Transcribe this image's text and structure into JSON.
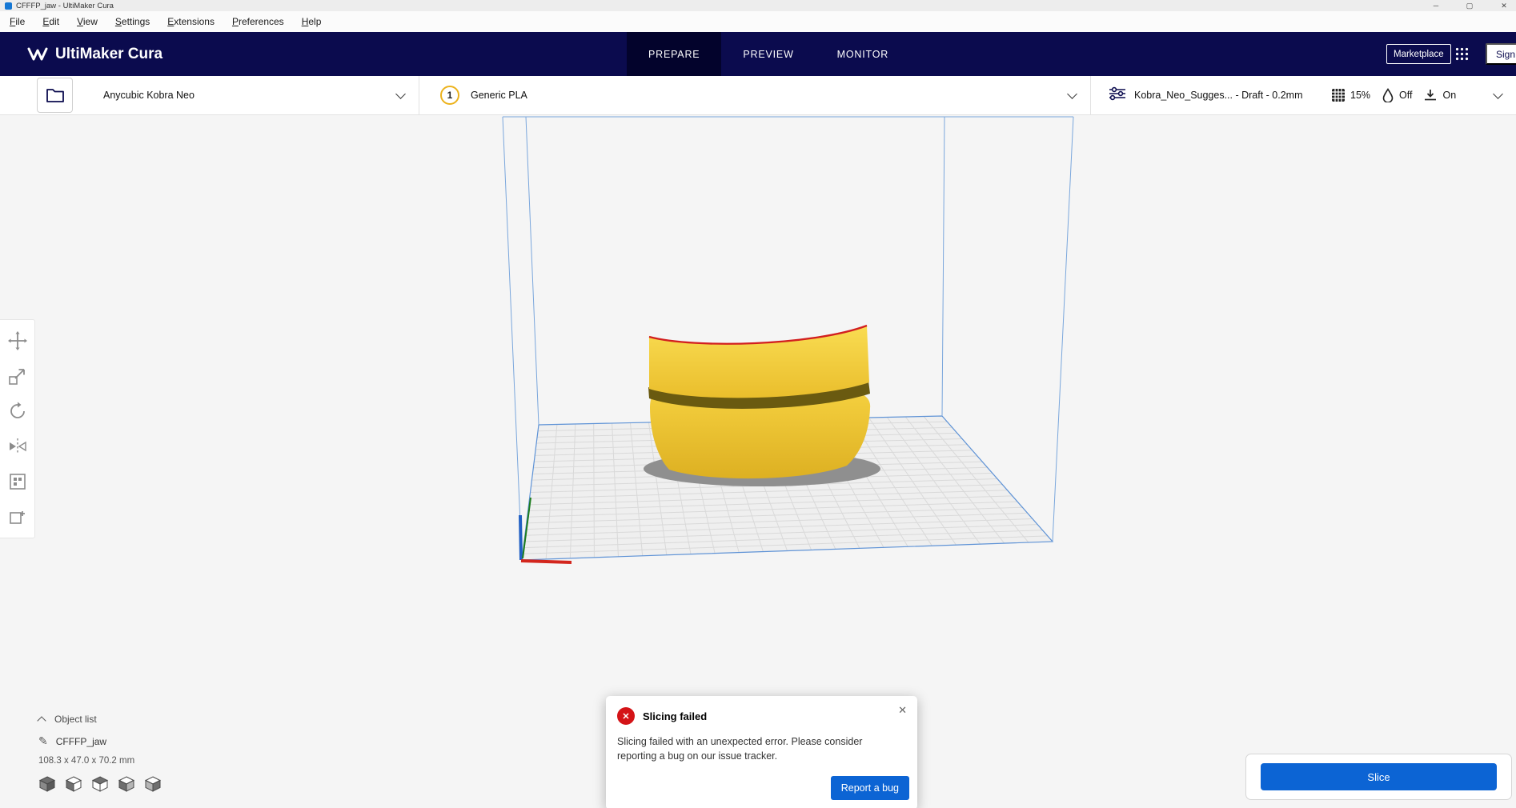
{
  "window": {
    "title": "CFFFP_jaw - UltiMaker Cura"
  },
  "icons": {
    "minimize": "─",
    "maximize": "▢",
    "close": "✕",
    "dialog_close": "✕",
    "error_cross": "✕",
    "pencil": "✎"
  },
  "menu": {
    "items": [
      "File",
      "Edit",
      "View",
      "Settings",
      "Extensions",
      "Preferences",
      "Help"
    ]
  },
  "header": {
    "app_name": "UltiMaker Cura",
    "tabs": [
      {
        "label": "PREPARE",
        "active": true
      },
      {
        "label": "PREVIEW",
        "active": false
      },
      {
        "label": "MONITOR",
        "active": false
      }
    ],
    "marketplace_label": "Marketplace",
    "sign_in_label": "Sign in"
  },
  "config_bar": {
    "printer_name": "Anycubic Kobra Neo",
    "extruder_number": "1",
    "material_name": "Generic PLA",
    "profile_summary": "Kobra_Neo_Sugges... - Draft - 0.2mm",
    "infill_value": "15%",
    "support_value": "Off",
    "adhesion_value": "On"
  },
  "scene": {
    "object_list_label": "Object list",
    "object_name": "CFFFP_jaw",
    "object_dimensions": "108.3 x 47.0 x 70.2 mm"
  },
  "dialog": {
    "title": "Slicing failed",
    "message": "Slicing failed with an unexpected error. Please consider reporting a bug on our issue tracker.",
    "report_button_label": "Report a bug"
  },
  "action_panel": {
    "slice_button_label": "Slice"
  },
  "colors": {
    "header_bg": "#0b0b4e",
    "accent_blue": "#0c64d4",
    "model_yellow": "#f6d33c",
    "error_red": "#d41317",
    "build_line_blue": "#5f93d6"
  }
}
